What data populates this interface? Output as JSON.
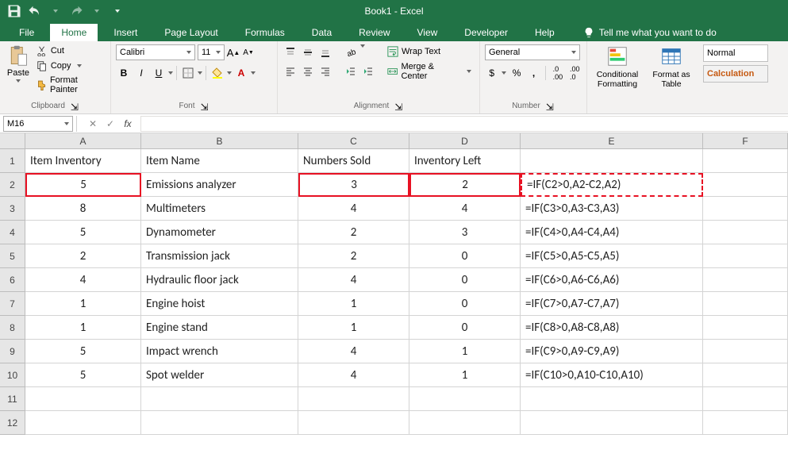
{
  "title": "Book1  -  Excel",
  "qat": {
    "save": "Save",
    "undo": "Undo",
    "redo": "Redo",
    "customize": "Customize"
  },
  "tabs": [
    "File",
    "Home",
    "Insert",
    "Page Layout",
    "Formulas",
    "Data",
    "Review",
    "View",
    "Developer",
    "Help"
  ],
  "active_tab": "Home",
  "tell_me": "Tell me what you want to do",
  "clipboard": {
    "paste": "Paste",
    "cut": "Cut",
    "copy": "Copy",
    "format_painter": "Format Painter",
    "label": "Clipboard"
  },
  "font": {
    "name": "Calibri",
    "size": "11",
    "bold": "B",
    "italic": "I",
    "underline": "U",
    "inc": "A",
    "dec": "A",
    "label": "Font"
  },
  "alignment": {
    "wrap": "Wrap Text",
    "merge": "Merge & Center",
    "label": "Alignment"
  },
  "number": {
    "format": "General",
    "label": "Number"
  },
  "styles": {
    "conditional": "Conditional Formatting",
    "format_table": "Format as Table",
    "normal": "Normal",
    "calculation": "Calculation"
  },
  "namebox": "M16",
  "formula": "",
  "columns": [
    "A",
    "B",
    "C",
    "D",
    "E",
    "F"
  ],
  "grid": {
    "headers": [
      "Item Inventory",
      "Item Name",
      "Numbers Sold",
      "Inventory Left",
      "",
      ""
    ],
    "rows": [
      {
        "A": "5",
        "B": "Emissions analyzer",
        "C": "3",
        "D": "2",
        "E": "=IF(C2>0,A2-C2,A2)"
      },
      {
        "A": "8",
        "B": "Multimeters",
        "C": "4",
        "D": "4",
        "E": "=IF(C3>0,A3-C3,A3)"
      },
      {
        "A": "5",
        "B": "Dynamometer",
        "C": "2",
        "D": "3",
        "E": "=IF(C4>0,A4-C4,A4)"
      },
      {
        "A": "2",
        "B": "Transmission jack",
        "C": "2",
        "D": "0",
        "E": "=IF(C5>0,A5-C5,A5)"
      },
      {
        "A": "4",
        "B": "Hydraulic floor jack",
        "C": "4",
        "D": "0",
        "E": "=IF(C6>0,A6-C6,A6)"
      },
      {
        "A": "1",
        "B": "Engine hoist",
        "C": "1",
        "D": "0",
        "E": "=IF(C7>0,A7-C7,A7)"
      },
      {
        "A": "1",
        "B": "Engine stand",
        "C": "1",
        "D": "0",
        "E": "=IF(C8>0,A8-C8,A8)"
      },
      {
        "A": "5",
        "B": "Impact wrench",
        "C": "4",
        "D": "1",
        "E": "=IF(C9>0,A9-C9,A9)"
      },
      {
        "A": "5",
        "B": "Spot welder",
        "C": "4",
        "D": "1",
        "E": "=IF(C10>0,A10-C10,A10)"
      }
    ],
    "empty_rows": 2
  }
}
